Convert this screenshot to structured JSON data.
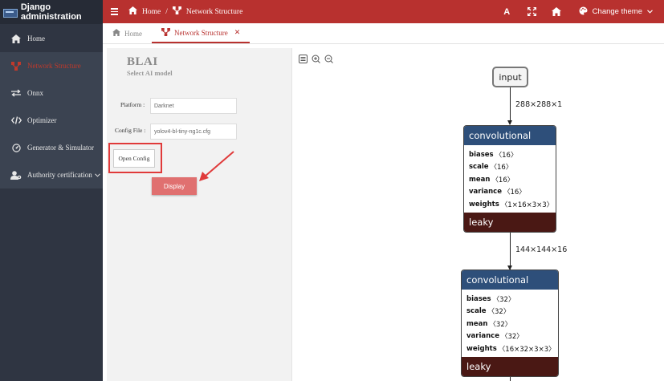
{
  "app": {
    "title": "Django administration"
  },
  "sidebar": {
    "items": [
      {
        "label": "Home",
        "icon": "home-icon"
      },
      {
        "label": "Network Structure",
        "icon": "network-icon",
        "active": true
      },
      {
        "label": "Onnx",
        "icon": "swap-icon"
      },
      {
        "label": "Optimizer",
        "icon": "code-icon"
      },
      {
        "label": "Generator & Simulator",
        "icon": "gauge-icon"
      },
      {
        "label": "Authority certification",
        "icon": "user-cog-icon"
      }
    ]
  },
  "header": {
    "breadcrumb": {
      "home": "Home",
      "separator": "/",
      "current": "Network Structure"
    },
    "font_icon": "A",
    "change_theme": "Change theme",
    "accent_color": "#b8312f"
  },
  "tabs": [
    {
      "label": "Home",
      "icon": "home-icon"
    },
    {
      "label": "Network Structure",
      "icon": "network-icon",
      "active": true,
      "close": "✕"
    }
  ],
  "form": {
    "title": "BLAI",
    "subtitle": "Select AI model",
    "platform_label": "Platform :",
    "platform_value": "Darknet",
    "config_label": "Config File :",
    "config_value": "yolov4-bl-tiny-ng1c.cfg",
    "open_config": "Open Config",
    "display": "Display"
  },
  "graph": {
    "input_node": "input",
    "edges": [
      "288×288×1",
      "144×144×16"
    ],
    "layers": [
      {
        "type": "convolutional",
        "attrs": [
          {
            "name": "biases",
            "value": "〈16〉"
          },
          {
            "name": "scale",
            "value": "〈16〉"
          },
          {
            "name": "mean",
            "value": "〈16〉"
          },
          {
            "name": "variance",
            "value": "〈16〉"
          },
          {
            "name": "weights",
            "value": "〈1×16×3×3〉"
          }
        ],
        "activation": "leaky"
      },
      {
        "type": "convolutional",
        "attrs": [
          {
            "name": "biases",
            "value": "〈32〉"
          },
          {
            "name": "scale",
            "value": "〈32〉"
          },
          {
            "name": "mean",
            "value": "〈32〉"
          },
          {
            "name": "variance",
            "value": "〈32〉"
          },
          {
            "name": "weights",
            "value": "〈16×32×3×3〉"
          }
        ],
        "activation": "leaky"
      }
    ]
  }
}
